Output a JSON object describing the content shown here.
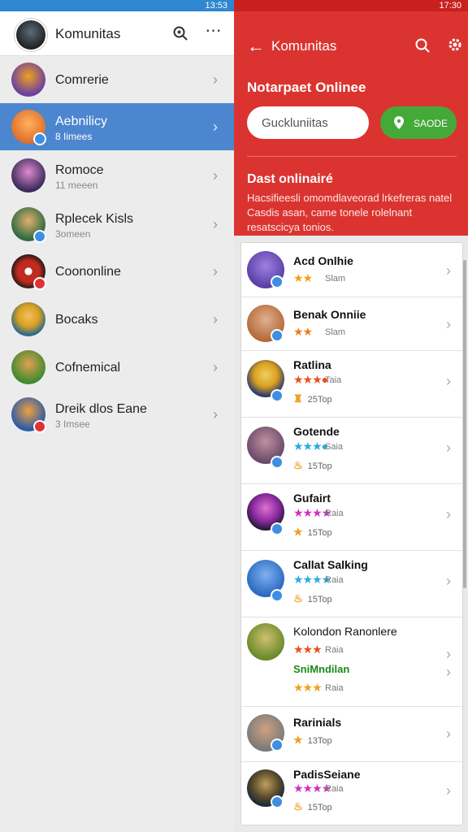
{
  "left_panel": {
    "status_time": "13:53",
    "title": "Komunitas",
    "items": [
      {
        "name": "Comrerie",
        "sub": "",
        "selected": false,
        "color": "#6a3fa0"
      },
      {
        "name": "Aebnilicy",
        "sub": "8 Iimees",
        "selected": true,
        "color": "#e0702a"
      },
      {
        "name": "Romoce",
        "sub": "11 meeen",
        "selected": false,
        "color": "#8a4aa8"
      },
      {
        "name": "Rplecek Kisls",
        "sub": "3omeen",
        "selected": false,
        "color": "#2d6a3e"
      },
      {
        "name": "Coononline",
        "sub": "",
        "selected": false,
        "color": "#c12a1e"
      },
      {
        "name": "Bocaks",
        "sub": "",
        "selected": false,
        "color": "#d9a020"
      },
      {
        "name": "Cofnemical",
        "sub": "",
        "selected": false,
        "color": "#3f8a30"
      },
      {
        "name": "Dreik dlos Eane",
        "sub": "3 Imsee",
        "selected": false,
        "color": "#2a5aa8"
      }
    ]
  },
  "right_panel": {
    "status_time": "17:30",
    "title": "Komunitas",
    "heading": "Notarpaet Onlinee",
    "search_placeholder": "Guckluniitas",
    "action_button": "SAODE",
    "section_title": "Dast onlinairé",
    "section_desc": "Hacsifieesli omomdlaveorad lrkefreras natel Casdis asan, came tonele rolelnant resatscicya tonios.",
    "items": [
      {
        "name": "Acd Onlhie",
        "stars": "★★",
        "tag": "Slam",
        "stat": "",
        "name2": "",
        "color": "#5a3fa8"
      },
      {
        "name": "Benak Onniie",
        "stars": "★★",
        "tag": "Slam",
        "stat": "",
        "name2": "",
        "color": "#b56a3a"
      },
      {
        "name": "Ratlina",
        "stars": "★★★●",
        "tag": "Taia",
        "stat": "25Top",
        "name2": "",
        "color": "#d9a020"
      },
      {
        "name": "Gotende",
        "stars": "★★★●",
        "tag": "Saia",
        "stat": "15Top",
        "name2": "",
        "color": "#6a4a6a"
      },
      {
        "name": "Gufairt",
        "stars": "★★★★",
        "tag": "Raia",
        "stat": "15Top",
        "name2": "",
        "color": "#8a2aa0"
      },
      {
        "name": "Callat Salking",
        "stars": "★★★★",
        "tag": "Raia",
        "stat": "15Top",
        "name2": "",
        "color": "#2a6ac0"
      },
      {
        "name": "Kolondon Ranonlere",
        "stars": "★★★",
        "tag": "Raia",
        "stat": "",
        "name2": "SniMndilan",
        "stars2": "★★★",
        "tag2": "Raia",
        "color": "#6a8a2a"
      },
      {
        "name": "Rarinials",
        "stars": "★",
        "tag": "",
        "stat": "13Top",
        "name2": "",
        "color": "#7a7a7a"
      },
      {
        "name": "PadisSeiane",
        "stars": "★★★★",
        "tag": "Raia",
        "stat": "15Top",
        "name2": "",
        "color": "#5a4a2a"
      }
    ]
  }
}
